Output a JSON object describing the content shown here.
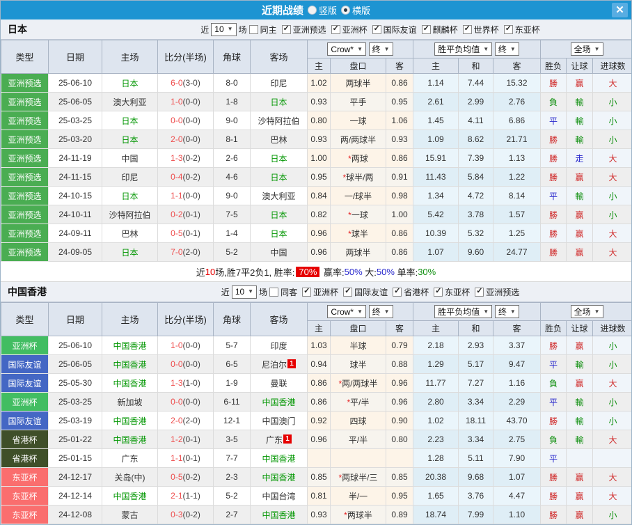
{
  "title_bar": {
    "title": "近期战绩",
    "radio_vertical": "竖版",
    "radio_horizontal": "横版",
    "horizontal_selected": true,
    "close": "✕"
  },
  "table_header": {
    "main_cols": [
      "类型",
      "日期",
      "主场",
      "比分(半场)",
      "角球",
      "客场"
    ],
    "odds_provider_select": "Crow*",
    "odds_stage_select": "终",
    "odds_sub_cols": [
      "主",
      "盘口",
      "客"
    ],
    "avg_select": "胜平负均值",
    "avg_stage_select": "终",
    "avg_sub_cols": [
      "主",
      "和",
      "客"
    ],
    "scope_select": "全场",
    "result_sub_cols": [
      "胜负",
      "让球",
      "进球数"
    ]
  },
  "type_colors": {
    "亚洲预选": "#4aad52",
    "亚洲杯": "#42bd62",
    "国际友谊": "#4467c4",
    "省港杯": "#3f4f29",
    "东亚杯": "#fa6e6e"
  },
  "result_colors": {
    "勝": "#d02a2a",
    "負": "#0f8f0f",
    "平": "#2626cc",
    "赢": "#d02a2a",
    "輸": "#0f8f0f",
    "走": "#2626cc",
    "大": "#d02a2a",
    "小": "#0f8f0f"
  },
  "sections": [
    {
      "team": "日本",
      "filter": {
        "prefix": "近",
        "count": "10",
        "suffix": "场",
        "same_venue_label": "同主",
        "same_venue_checked": false,
        "competitions": [
          {
            "label": "亚洲预选",
            "checked": true
          },
          {
            "label": "亚洲杯",
            "checked": true
          },
          {
            "label": "国际友谊",
            "checked": true
          },
          {
            "label": "麒麟杯",
            "checked": true
          },
          {
            "label": "世界杯",
            "checked": true
          },
          {
            "label": "东亚杯",
            "checked": true
          }
        ]
      },
      "rows": [
        {
          "type": "亚洲预选",
          "date": "25-06-10",
          "home": "日本",
          "homeFocus": true,
          "score": "6-0",
          "half": "(3-0)",
          "corners": "8-0",
          "away": "印尼",
          "awayFocus": false,
          "awayBadge": "",
          "oddsHome": "1.02",
          "handicap": "两球半",
          "oddsAway": "0.86",
          "avgHome": "1.14",
          "avgDraw": "7.44",
          "avgAway": "15.32",
          "wdl": "勝",
          "let": "赢",
          "goals": "大"
        },
        {
          "type": "亚洲预选",
          "date": "25-06-05",
          "home": "澳大利亚",
          "homeFocus": false,
          "score": "1-0",
          "half": "(0-0)",
          "corners": "1-8",
          "away": "日本",
          "awayFocus": true,
          "awayBadge": "",
          "oddsHome": "0.93",
          "handicap": "平手",
          "oddsAway": "0.95",
          "avgHome": "2.61",
          "avgDraw": "2.99",
          "avgAway": "2.76",
          "wdl": "負",
          "let": "輸",
          "goals": "小"
        },
        {
          "type": "亚洲预选",
          "date": "25-03-25",
          "home": "日本",
          "homeFocus": true,
          "score": "0-0",
          "half": "(0-0)",
          "corners": "9-0",
          "away": "沙特阿拉伯",
          "awayFocus": false,
          "awayBadge": "",
          "oddsHome": "0.80",
          "handicap": "一球",
          "oddsAway": "1.06",
          "avgHome": "1.45",
          "avgDraw": "4.11",
          "avgAway": "6.86",
          "wdl": "平",
          "let": "輸",
          "goals": "小"
        },
        {
          "type": "亚洲预选",
          "date": "25-03-20",
          "home": "日本",
          "homeFocus": true,
          "score": "2-0",
          "half": "(0-0)",
          "corners": "8-1",
          "away": "巴林",
          "awayFocus": false,
          "awayBadge": "",
          "oddsHome": "0.93",
          "handicap": "两/两球半",
          "oddsAway": "0.93",
          "avgHome": "1.09",
          "avgDraw": "8.62",
          "avgAway": "21.71",
          "wdl": "勝",
          "let": "輸",
          "goals": "小"
        },
        {
          "type": "亚洲预选",
          "date": "24-11-19",
          "home": "中国",
          "homeFocus": false,
          "score": "1-3",
          "half": "(0-2)",
          "corners": "2-6",
          "away": "日本",
          "awayFocus": true,
          "awayBadge": "",
          "oddsHome": "1.00",
          "handicap": "*两球",
          "oddsAway": "0.86",
          "avgHome": "15.91",
          "avgDraw": "7.39",
          "avgAway": "1.13",
          "wdl": "勝",
          "let": "走",
          "goals": "大"
        },
        {
          "type": "亚洲预选",
          "date": "24-11-15",
          "home": "印尼",
          "homeFocus": false,
          "score": "0-4",
          "half": "(0-2)",
          "corners": "4-6",
          "away": "日本",
          "awayFocus": true,
          "awayBadge": "",
          "oddsHome": "0.95",
          "handicap": "*球半/两",
          "oddsAway": "0.91",
          "avgHome": "11.43",
          "avgDraw": "5.84",
          "avgAway": "1.22",
          "wdl": "勝",
          "let": "赢",
          "goals": "大"
        },
        {
          "type": "亚洲预选",
          "date": "24-10-15",
          "home": "日本",
          "homeFocus": true,
          "score": "1-1",
          "half": "(0-0)",
          "corners": "9-0",
          "away": "澳大利亚",
          "awayFocus": false,
          "awayBadge": "",
          "oddsHome": "0.84",
          "handicap": "一/球半",
          "oddsAway": "0.98",
          "avgHome": "1.34",
          "avgDraw": "4.72",
          "avgAway": "8.14",
          "wdl": "平",
          "let": "輸",
          "goals": "小"
        },
        {
          "type": "亚洲预选",
          "date": "24-10-11",
          "home": "沙特阿拉伯",
          "homeFocus": false,
          "score": "0-2",
          "half": "(0-1)",
          "corners": "7-5",
          "away": "日本",
          "awayFocus": true,
          "awayBadge": "",
          "oddsHome": "0.82",
          "handicap": "*一球",
          "oddsAway": "1.00",
          "avgHome": "5.42",
          "avgDraw": "3.78",
          "avgAway": "1.57",
          "wdl": "勝",
          "let": "赢",
          "goals": "小"
        },
        {
          "type": "亚洲预选",
          "date": "24-09-11",
          "home": "巴林",
          "homeFocus": false,
          "score": "0-5",
          "half": "(0-1)",
          "corners": "1-4",
          "away": "日本",
          "awayFocus": true,
          "awayBadge": "",
          "oddsHome": "0.96",
          "handicap": "*球半",
          "oddsAway": "0.86",
          "avgHome": "10.39",
          "avgDraw": "5.32",
          "avgAway": "1.25",
          "wdl": "勝",
          "let": "赢",
          "goals": "大"
        },
        {
          "type": "亚洲预选",
          "date": "24-09-05",
          "home": "日本",
          "homeFocus": true,
          "score": "7-0",
          "half": "(2-0)",
          "corners": "5-2",
          "away": "中国",
          "awayFocus": false,
          "awayBadge": "",
          "oddsHome": "0.96",
          "handicap": "两球半",
          "oddsAway": "0.86",
          "avgHome": "1.07",
          "avgDraw": "9.60",
          "avgAway": "24.77",
          "wdl": "勝",
          "let": "赢",
          "goals": "大"
        }
      ],
      "summary_parts": [
        {
          "t": "近",
          "c": "#222"
        },
        {
          "t": "10",
          "c": "#e60000"
        },
        {
          "t": "场,胜7平2负1, 胜率:",
          "c": "#222"
        },
        {
          "t": "70%",
          "c": "#ffffff",
          "bg": "#e60000"
        },
        {
          "t": " 赢率:",
          "c": "#222"
        },
        {
          "t": "50%",
          "c": "#2626cc"
        },
        {
          "t": " 大:",
          "c": "#222"
        },
        {
          "t": "50%",
          "c": "#2626cc"
        },
        {
          "t": " 单率:",
          "c": "#222"
        },
        {
          "t": "30%",
          "c": "#0f8f0f"
        }
      ]
    },
    {
      "team": "中国香港",
      "filter": {
        "prefix": "近",
        "count": "10",
        "suffix": "场",
        "same_venue_label": "同客",
        "same_venue_checked": false,
        "competitions": [
          {
            "label": "亚洲杯",
            "checked": true
          },
          {
            "label": "国际友谊",
            "checked": true
          },
          {
            "label": "省港杯",
            "checked": true
          },
          {
            "label": "东亚杯",
            "checked": true
          },
          {
            "label": "亚洲预选",
            "checked": true
          }
        ]
      },
      "rows": [
        {
          "type": "亚洲杯",
          "date": "25-06-10",
          "home": "中国香港",
          "homeFocus": true,
          "score": "1-0",
          "half": "(0-0)",
          "corners": "5-7",
          "away": "印度",
          "awayFocus": false,
          "awayBadge": "",
          "oddsHome": "1.03",
          "handicap": "半球",
          "oddsAway": "0.79",
          "avgHome": "2.18",
          "avgDraw": "2.93",
          "avgAway": "3.37",
          "wdl": "勝",
          "let": "赢",
          "goals": "小"
        },
        {
          "type": "国际友谊",
          "date": "25-06-05",
          "home": "中国香港",
          "homeFocus": true,
          "score": "0-0",
          "half": "(0-0)",
          "corners": "6-5",
          "away": "尼泊尔",
          "awayFocus": false,
          "awayBadge": "1",
          "oddsHome": "0.94",
          "handicap": "球半",
          "oddsAway": "0.88",
          "avgHome": "1.29",
          "avgDraw": "5.17",
          "avgAway": "9.47",
          "wdl": "平",
          "let": "輸",
          "goals": "小"
        },
        {
          "type": "国际友谊",
          "date": "25-05-30",
          "home": "中国香港",
          "homeFocus": true,
          "score": "1-3",
          "half": "(1-0)",
          "corners": "1-9",
          "away": "曼联",
          "awayFocus": false,
          "awayBadge": "",
          "oddsHome": "0.86",
          "handicap": "*两/两球半",
          "oddsAway": "0.96",
          "avgHome": "11.77",
          "avgDraw": "7.27",
          "avgAway": "1.16",
          "wdl": "負",
          "let": "赢",
          "goals": "大"
        },
        {
          "type": "亚洲杯",
          "date": "25-03-25",
          "home": "新加坡",
          "homeFocus": false,
          "score": "0-0",
          "half": "(0-0)",
          "corners": "6-11",
          "away": "中国香港",
          "awayFocus": true,
          "awayBadge": "",
          "oddsHome": "0.86",
          "handicap": "*平/半",
          "oddsAway": "0.96",
          "avgHome": "2.80",
          "avgDraw": "3.34",
          "avgAway": "2.29",
          "wdl": "平",
          "let": "輸",
          "goals": "小"
        },
        {
          "type": "国际友谊",
          "date": "25-03-19",
          "home": "中国香港",
          "homeFocus": true,
          "score": "2-0",
          "half": "(2-0)",
          "corners": "12-1",
          "away": "中国澳门",
          "awayFocus": false,
          "awayBadge": "",
          "oddsHome": "0.92",
          "handicap": "四球",
          "oddsAway": "0.90",
          "avgHome": "1.02",
          "avgDraw": "18.11",
          "avgAway": "43.70",
          "wdl": "勝",
          "let": "輸",
          "goals": "小"
        },
        {
          "type": "省港杯",
          "date": "25-01-22",
          "home": "中国香港",
          "homeFocus": true,
          "score": "1-2",
          "half": "(0-1)",
          "corners": "3-5",
          "away": "广东",
          "awayFocus": false,
          "awayBadge": "1",
          "oddsHome": "0.96",
          "handicap": "平/半",
          "oddsAway": "0.80",
          "avgHome": "2.23",
          "avgDraw": "3.34",
          "avgAway": "2.75",
          "wdl": "負",
          "let": "輸",
          "goals": "大"
        },
        {
          "type": "省港杯",
          "date": "25-01-15",
          "home": "广东",
          "homeFocus": false,
          "score": "1-1",
          "half": "(0-1)",
          "corners": "7-7",
          "away": "中国香港",
          "awayFocus": true,
          "awayBadge": "",
          "oddsHome": "",
          "handicap": "",
          "oddsAway": "",
          "avgHome": "1.28",
          "avgDraw": "5.11",
          "avgAway": "7.90",
          "wdl": "平",
          "let": "",
          "goals": ""
        },
        {
          "type": "东亚杯",
          "date": "24-12-17",
          "home": "关岛(中)",
          "homeFocus": false,
          "score": "0-5",
          "half": "(0-2)",
          "corners": "2-3",
          "away": "中国香港",
          "awayFocus": true,
          "awayBadge": "",
          "oddsHome": "0.85",
          "handicap": "*两球半/三",
          "oddsAway": "0.85",
          "avgHome": "20.38",
          "avgDraw": "9.68",
          "avgAway": "1.07",
          "wdl": "勝",
          "let": "赢",
          "goals": "大"
        },
        {
          "type": "东亚杯",
          "date": "24-12-14",
          "home": "中国香港",
          "homeFocus": true,
          "score": "2-1",
          "half": "(1-1)",
          "corners": "5-2",
          "away": "中国台湾",
          "awayFocus": false,
          "awayBadge": "",
          "oddsHome": "0.81",
          "handicap": "半/一",
          "oddsAway": "0.95",
          "avgHome": "1.65",
          "avgDraw": "3.76",
          "avgAway": "4.47",
          "wdl": "勝",
          "let": "赢",
          "goals": "大"
        },
        {
          "type": "东亚杯",
          "date": "24-12-08",
          "home": "蒙古",
          "homeFocus": false,
          "score": "0-3",
          "half": "(0-2)",
          "corners": "2-7",
          "away": "中国香港",
          "awayFocus": true,
          "awayBadge": "",
          "oddsHome": "0.93",
          "handicap": "*两球半",
          "oddsAway": "0.89",
          "avgHome": "18.74",
          "avgDraw": "7.99",
          "avgAway": "1.10",
          "wdl": "勝",
          "let": "赢",
          "goals": "小"
        }
      ],
      "summary_parts": null
    }
  ]
}
